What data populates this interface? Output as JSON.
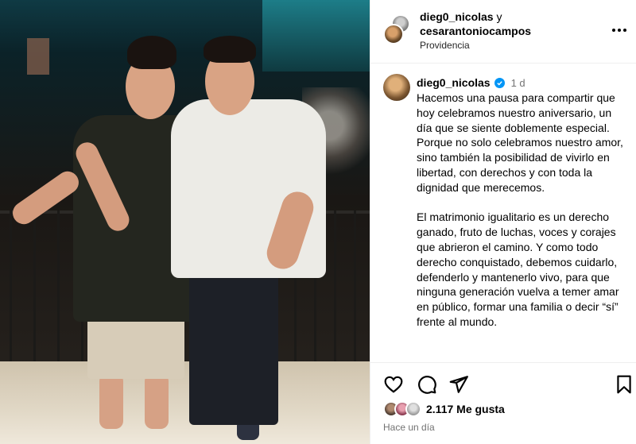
{
  "post_header": {
    "username_primary": "dieg0_nicolas",
    "connector": " y",
    "username_secondary": "cesarantoniocampos",
    "location": "Providencia",
    "more_label": "•••"
  },
  "caption": {
    "username": "dieg0_nicolas",
    "time": "1 d",
    "paragraphs": [
      "Hacemos una pausa para compartir que hoy celebramos nuestro aniversario, un día que se siente doblemente especial.",
      "Porque no solo celebramos nuestro amor, sino también la posibilidad de vivirlo en libertad, con derechos y con toda la dignidad que merecemos.",
      "",
      "El matrimonio igualitario es un derecho ganado, fruto de luchas, voces y corajes que abrieron el camino. Y como todo derecho conquistado, debemos cuidarlo, defenderlo y mantenerlo vivo, para que ninguna generación vuelva a temer amar en público, formar una familia o decir “sí” frente al mundo."
    ]
  },
  "actions": {
    "like_icon": "heart-icon",
    "comment_icon": "comment-icon",
    "share_icon": "send-icon",
    "save_icon": "bookmark-icon"
  },
  "likes": {
    "count_text": "2.117 Me gusta"
  },
  "post_age": "Hace un día",
  "colors": {
    "verified": "#0095f6",
    "secondary_text": "#737373",
    "border": "#efefef"
  }
}
